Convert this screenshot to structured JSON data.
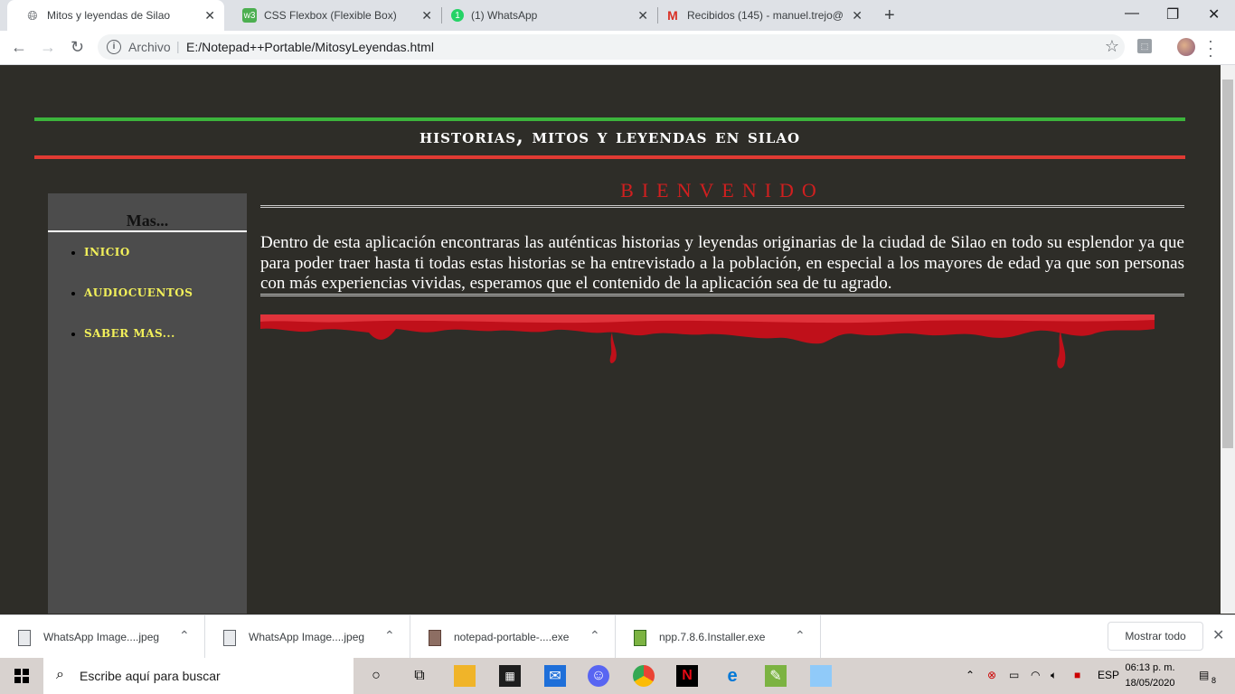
{
  "browser": {
    "tabs": [
      {
        "title": "Mitos y leyendas de Silao",
        "active": true
      },
      {
        "title": "CSS Flexbox (Flexible Box)",
        "active": false
      },
      {
        "title": "(1) WhatsApp",
        "active": false
      },
      {
        "title": "Recibidos (145) - manuel.trejo@",
        "active": false
      }
    ],
    "new_tab": "+",
    "close_glyph": "✕",
    "window": {
      "minimize": "—",
      "restore": "❐",
      "close": "✕"
    },
    "nav": {
      "back": "←",
      "forward": "→",
      "reload": "↻"
    },
    "address": {
      "scheme_label": "Archivo",
      "separator": "|",
      "url": "E:/Notepad++Portable/MitosyLeyendas.html"
    },
    "bookmark_icon": "☆"
  },
  "page": {
    "site_title": "historias, mitos y leyendas en silao",
    "sidebar": {
      "title": "Mas...",
      "items": [
        "INICIO",
        "AUDIOCUENTOS",
        "SABER MAS..."
      ]
    },
    "welcome": "BIENVENIDO",
    "intro": "Dentro de esta aplicación encontraras las auténticas historias y leyendas originarias de la ciudad de Silao en todo su esplendor ya que para poder traer hasta ti todas estas historias se ha entrevistado a la población, en especial a los mayores de edad ya que son personas con más experiencias vividas, esperamos que el contenido de la aplicación sea de tu agrado.",
    "colors": {
      "background": "#2e2d28",
      "green_bar": "#3cb43c",
      "red_bar": "#e03a33",
      "welcome": "#d11f1f",
      "menu_link": "#f2f05a",
      "blood": "#c0101a"
    }
  },
  "downloads": {
    "items": [
      {
        "name": "WhatsApp Image....jpeg"
      },
      {
        "name": "WhatsApp Image....jpeg"
      },
      {
        "name": "notepad-portable-....exe"
      },
      {
        "name": "npp.7.8.6.Installer.exe"
      }
    ],
    "show_all": "Mostrar todo",
    "close": "✕"
  },
  "taskbar": {
    "search_placeholder": "Escribe aquí para buscar",
    "language": "ESP",
    "time": "06:13 p. m.",
    "date": "18/05/2020",
    "notifications": "8"
  }
}
